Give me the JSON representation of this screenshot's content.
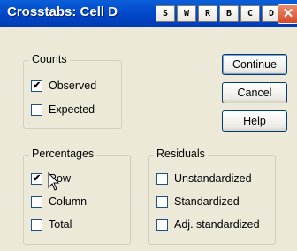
{
  "window": {
    "title": "Crosstabs: Cell D",
    "close_glyph": "✕"
  },
  "title_buttons": [
    "S",
    "W",
    "R",
    "B",
    "C",
    "D"
  ],
  "counts": {
    "legend": "Counts",
    "items": [
      {
        "label": "Observed",
        "checked": true
      },
      {
        "label": "Expected",
        "checked": false
      }
    ]
  },
  "percentages": {
    "legend": "Percentages",
    "items": [
      {
        "label": "Row",
        "checked": true
      },
      {
        "label": "Column",
        "checked": false
      },
      {
        "label": "Total",
        "checked": false
      }
    ]
  },
  "residuals": {
    "legend": "Residuals",
    "items": [
      {
        "label": "Unstandardized",
        "checked": false
      },
      {
        "label": "Standardized",
        "checked": false
      },
      {
        "label": "Adj. standardized",
        "checked": false
      }
    ]
  },
  "buttons": {
    "continue": "Continue",
    "cancel": "Cancel",
    "help": "Help"
  },
  "check_glyph": "✔"
}
